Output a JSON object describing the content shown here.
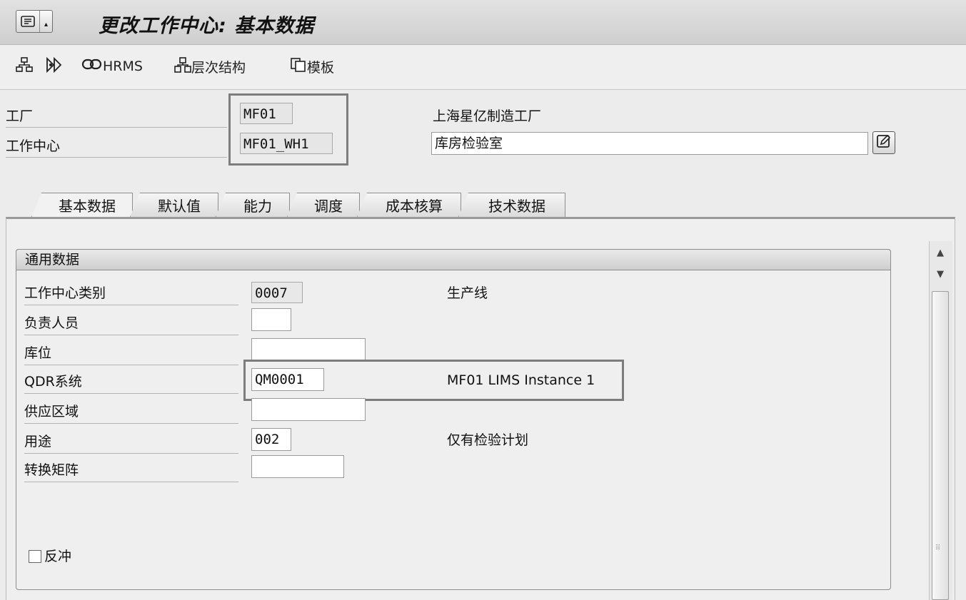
{
  "title": "更改工作中心: 基本数据",
  "toolbar": {
    "hrms_label": "HRMS",
    "hierarchy_label": "层次结构",
    "template_label": "模板"
  },
  "header": {
    "plant_label": "工厂",
    "plant_value": "MF01",
    "plant_desc": "上海星亿制造工厂",
    "workcenter_label": "工作中心",
    "workcenter_value": "MF01_WH1",
    "workcenter_desc": "库房检验室"
  },
  "tabs": [
    "基本数据",
    "默认值",
    "能力",
    "调度",
    "成本核算",
    "技术数据"
  ],
  "general": {
    "group_title": "通用数据",
    "wc_category_label": "工作中心类别",
    "wc_category_value": "0007",
    "wc_category_desc": "生产线",
    "person_resp_label": "负责人员",
    "person_resp_value": "",
    "location_label": "库位",
    "location_value": "",
    "qdr_label": "QDR系统",
    "qdr_value": "QM0001",
    "qdr_desc": "MF01 LIMS  Instance 1",
    "supply_area_label": "供应区域",
    "supply_area_value": "",
    "usage_label": "用途",
    "usage_value": "002",
    "usage_desc": "仅有检验计划",
    "matrix_label": "转换矩阵",
    "matrix_value": "",
    "backflush_label": "反冲"
  }
}
